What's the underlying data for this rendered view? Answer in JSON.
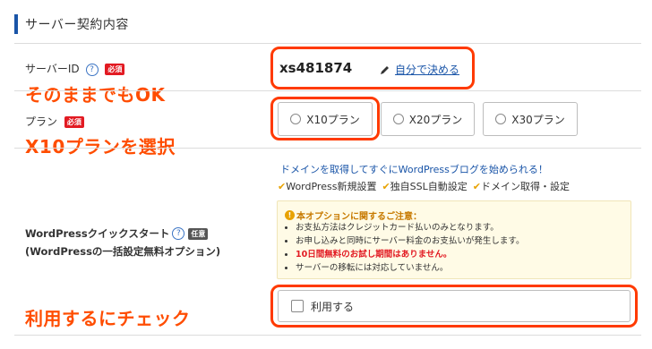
{
  "section": {
    "title": "サーバー契約内容"
  },
  "server_id": {
    "label": "サーバーID",
    "required": "必須",
    "value": "xs481874",
    "self_decide_link": "自分で決める",
    "annotation": "そのままでもOK"
  },
  "plan": {
    "label": "プラン",
    "required": "必須",
    "options": [
      {
        "label": "X10プラン"
      },
      {
        "label": "X20プラン"
      },
      {
        "label": "X30プラン"
      }
    ],
    "annotation": "X10プランを選択"
  },
  "wp_quick_start": {
    "label_line1": "WordPressクイックスタート",
    "optional": "任意",
    "label_line2": "(WordPressの一括設定無料オプション)",
    "promo_headline": "ドメインを取得してすぐにWordPressブログを始められる！",
    "features": [
      "WordPress新規設置",
      "独自SSL自動設定",
      "ドメイン取得・設定"
    ],
    "notice": {
      "title": "本オプションに関するご注意：",
      "items": [
        "お支払方法はクレジットカード払いのみとなります。",
        "お申し込みと同時にサーバー料金のお支払いが発生します。",
        "10日間無料のお試し期間はありません。",
        "サーバーの移転には対応していません。"
      ]
    },
    "checkbox_label": "利用する",
    "annotation": "利用するにチェック"
  },
  "colors": {
    "accent": "#1a55a8",
    "annotation": "#ff4d00",
    "required_badge": "#e21a22",
    "link": "#1a55a8",
    "check": "#e8a200"
  }
}
